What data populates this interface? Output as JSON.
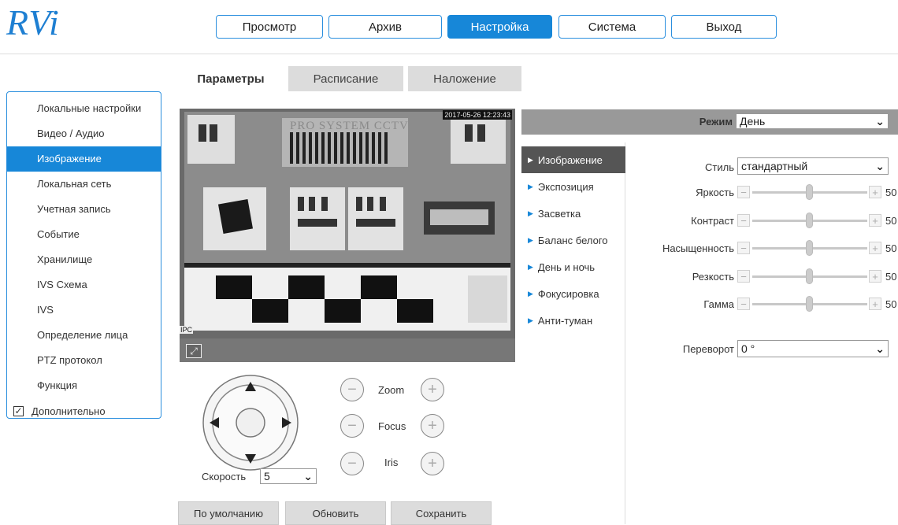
{
  "logo": "RVi",
  "nav": [
    "Просмотр",
    "Архив",
    "Настройка",
    "Система",
    "Выход"
  ],
  "tabs": [
    "Параметры",
    "Расписание",
    "Наложение"
  ],
  "sidebar": {
    "items": [
      "Локальные настройки",
      "Видео / Аудио",
      "Изображение",
      "Локальная сеть",
      "Учетная запись",
      "Событие",
      "Хранилище",
      "IVS Схема",
      "IVS",
      "Определение лица",
      "PTZ протокол",
      "Функция"
    ],
    "active_index": 2,
    "advanced_label": "Дополнительно"
  },
  "preview": {
    "timestamp": "2017-05-26 12:23:43",
    "overlay_brand": "PRO SYSTEM CCTV",
    "channel_label": "IPC",
    "fullscreen_icon": "fullscreen-icon"
  },
  "mode": {
    "label": "Режим",
    "value": "День"
  },
  "submenu": {
    "items": [
      "Изображение",
      "Экспозиция",
      "Засветка",
      "Баланс белого",
      "День и ночь",
      "Фокусировка",
      "Анти-туман"
    ],
    "active_index": 0
  },
  "image_settings": {
    "style_label": "Стиль",
    "style_value": "стандартный",
    "sliders": [
      {
        "label": "Яркость",
        "value": 50
      },
      {
        "label": "Контраст",
        "value": 50
      },
      {
        "label": "Насыщенность",
        "value": 50
      },
      {
        "label": "Резкость",
        "value": 50
      },
      {
        "label": "Гамма",
        "value": 50
      }
    ],
    "flip_label": "Переворот",
    "flip_value": "0 °"
  },
  "ptz": {
    "zoom": "Zoom",
    "focus": "Focus",
    "iris": "Iris",
    "speed_label": "Скорость",
    "speed_value": "5"
  },
  "buttons": {
    "default": "По умолчанию",
    "refresh": "Обновить",
    "save": "Сохранить"
  },
  "colors": {
    "accent": "#1787d8",
    "tab_inactive": "#dcdcdc",
    "mode_bar": "#999999",
    "submenu_active": "#555555"
  }
}
